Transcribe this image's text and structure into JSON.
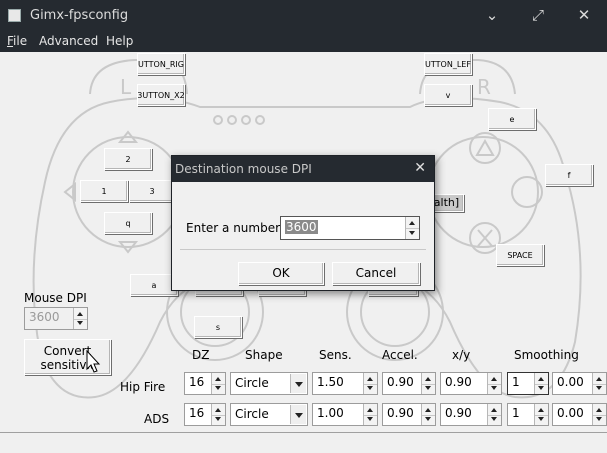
{
  "window": {
    "title": "Gimx-fpsconfig",
    "controls": [
      "minimize",
      "maximize",
      "close"
    ]
  },
  "menu": {
    "items": [
      {
        "mnemonic": "F",
        "rest": "ile"
      },
      {
        "mnemonic": "",
        "rest": "Advanced"
      },
      {
        "mnemonic": "",
        "rest": "Help"
      }
    ]
  },
  "pad_buttons": {
    "r1": "UTTON_RIG",
    "r2": "3UTTON_X2",
    "l1": "UTTON_LEF",
    "l2": "v",
    "up": "2",
    "left": "1",
    "right": "3",
    "down": "q",
    "triangle": "e",
    "circle": "f",
    "cross": "SPACE",
    "square_partial": "ealth]",
    "l3": "a",
    "r3": "s"
  },
  "mouse_dpi": {
    "label": "Mouse DPI",
    "value": "3600"
  },
  "convert_button": {
    "line1": "Convert",
    "line2": "sensitivit"
  },
  "columns": {
    "dz": "DZ",
    "shape": "Shape",
    "sens": "Sens.",
    "accel": "Accel.",
    "xy": "x/y",
    "smoothing": "Smoothing"
  },
  "rows": [
    {
      "label": "Hip Fire",
      "dz": "16",
      "shape": "Circle",
      "sens": "1.50",
      "accel": "0.90",
      "xy": "0.90",
      "smooth1": "1",
      "smooth2": "0.00"
    },
    {
      "label": "ADS",
      "dz": "16",
      "shape": "Circle",
      "sens": "1.00",
      "accel": "0.90",
      "xy": "0.90",
      "smooth1": "1",
      "smooth2": "0.00"
    }
  ],
  "dialog": {
    "title": "Destination mouse DPI",
    "prompt": "Enter a number:",
    "value": "3600",
    "ok": "OK",
    "cancel": "Cancel"
  }
}
